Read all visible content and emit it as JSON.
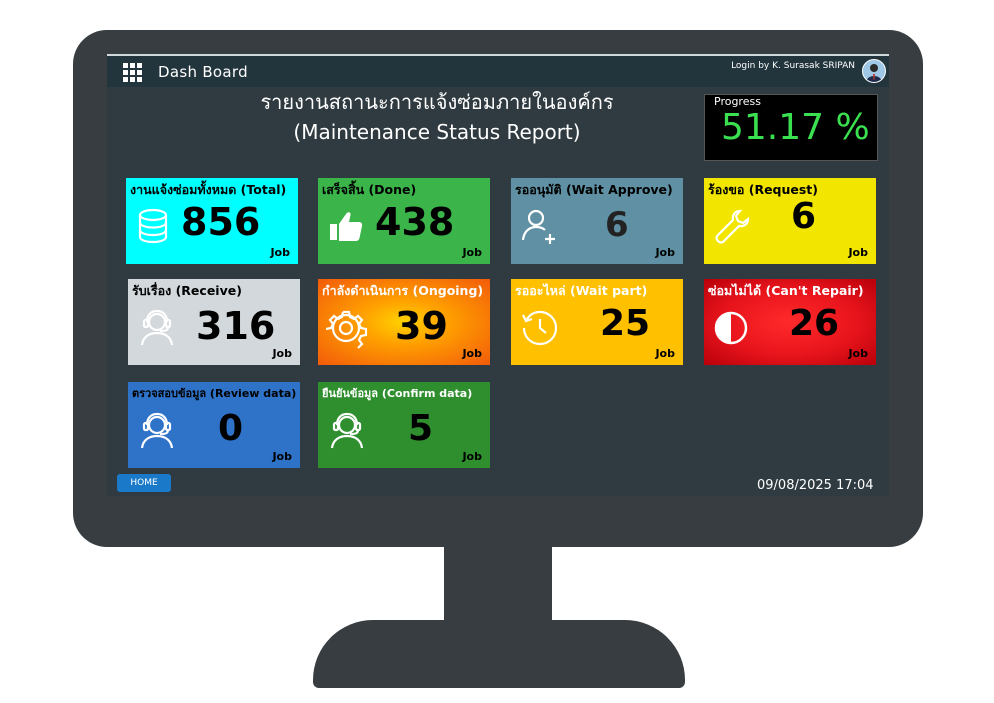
{
  "topbar": {
    "app_title": "Dash Board",
    "login_text": "Login by K. Surasak SRIPAN"
  },
  "header": {
    "title_thai": "รายงานสถานะการแจ้งซ่อมภายในองค์กร",
    "title_en": "(Maintenance Status Report)"
  },
  "progress": {
    "label": "Progress",
    "value": "51.17 %"
  },
  "tiles": [
    {
      "title": "งานแจ้งซ่อมทั้งหมด (Total)",
      "value": "856",
      "unit": "Job",
      "icon": "database-icon",
      "bg": "#00ffff"
    },
    {
      "title": "เสร็จสิ้น (Done)",
      "value": "438",
      "unit": "Job",
      "icon": "thumbs-up-icon",
      "bg": "#3bb54a"
    },
    {
      "title": "รออนุมัติ (Wait Approve)",
      "value": "6",
      "unit": "Job",
      "icon": "user-add-icon",
      "bg": "#5f90a3"
    },
    {
      "title": "ร้องขอ (Request)",
      "value": "6",
      "unit": "Job",
      "icon": "wrench-icon",
      "bg": "#f2e600"
    },
    {
      "title": "รับเรื่อง (Receive)",
      "value": "316",
      "unit": "Job",
      "icon": "headset-agent-icon",
      "bg": "#d3d8dc"
    },
    {
      "title": "กำลังดำเนินการ (Ongoing)",
      "value": "39",
      "unit": "Job",
      "icon": "gear-icon",
      "bg": "#f26f10"
    },
    {
      "title": "รออะไหล่ (Wait part)",
      "value": "25",
      "unit": "Job",
      "icon": "history-clock-icon",
      "bg": "#ffc000"
    },
    {
      "title": "ซ่อมไม่ได้ (Can't Repair)",
      "value": "26",
      "unit": "Job",
      "icon": "half-circle-icon",
      "bg": "#e8141c"
    },
    {
      "title": "ตรวจสอบข้อมูล (Review data)",
      "value": "0",
      "unit": "Job",
      "icon": "headset-agent-icon",
      "bg": "#2e73c8"
    },
    {
      "title": "ยืนยันข้อมูล (Confirm data)",
      "value": "5",
      "unit": "Job",
      "icon": "headset-agent-icon",
      "bg": "#2f8f2f"
    }
  ],
  "footer": {
    "home_label": "HOME",
    "datetime": "09/08/2025 17:04"
  }
}
